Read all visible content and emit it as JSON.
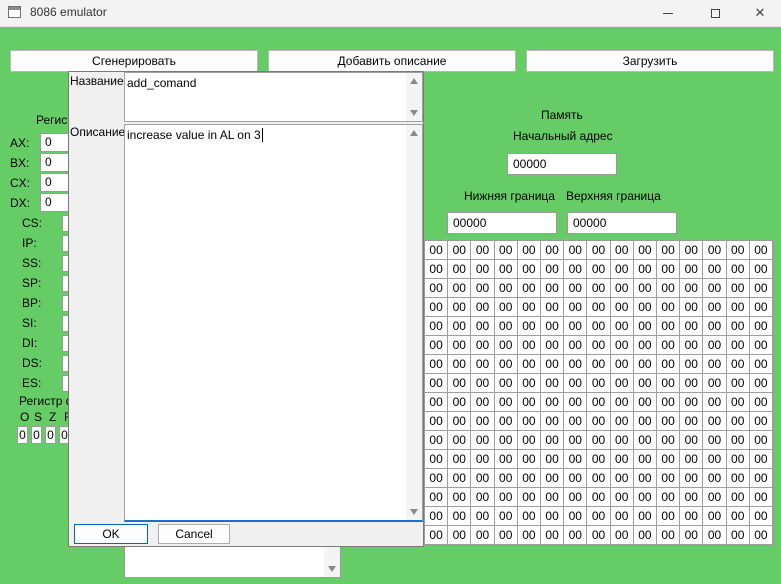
{
  "window": {
    "title": "8086 emulator",
    "icon": "app-window-icon"
  },
  "toolbar": {
    "generate_label": "Сгенерировать",
    "add_description_label": "Добавить описание",
    "load_label": "Загрузить"
  },
  "registers": {
    "title": "Регист",
    "general": [
      {
        "name": "AX:",
        "value": "0"
      },
      {
        "name": "BX:",
        "value": "0"
      },
      {
        "name": "CX:",
        "value": "0"
      },
      {
        "name": "DX:",
        "value": "0"
      }
    ],
    "segment": [
      "CS:",
      "IP:",
      "SS:",
      "SP:",
      "BP:",
      "SI:",
      "DI:",
      "DS:",
      "ES:"
    ]
  },
  "flags": {
    "title": "Регистр ф",
    "names": [
      "O",
      "S",
      "Z",
      "F"
    ],
    "values": [
      "0",
      "0",
      "0",
      "0"
    ]
  },
  "memory": {
    "title": "Память",
    "start_label": "Начальный адрес",
    "start_value": "00000",
    "lower_label": "Нижняя граница",
    "lower_value": "00000",
    "upper_label": "Верхняя граница",
    "upper_value": "00000",
    "cell_value": "00",
    "columns": 15,
    "rows": 16
  },
  "dialog": {
    "name_label": "Название",
    "name_value": "add_comand",
    "description_label": "Описание",
    "description_value": "increase value in AL on 3",
    "ok_label": "OK",
    "cancel_label": "Cancel"
  },
  "colors": {
    "background": "#66cc66",
    "accent": "#1e6fc8"
  }
}
